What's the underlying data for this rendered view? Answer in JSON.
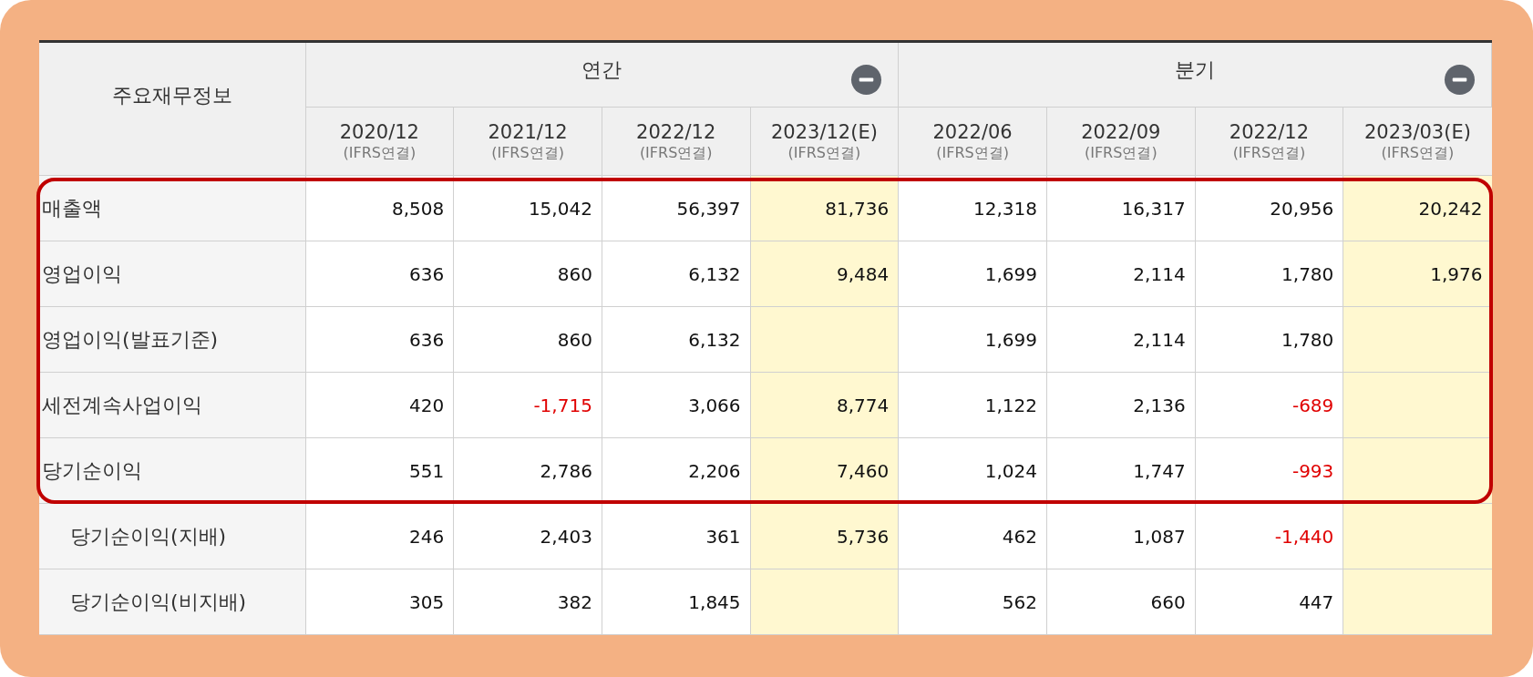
{
  "table": {
    "corner_label": "주요재무정보",
    "groups": [
      {
        "title": "연간",
        "expanded": true,
        "columns": [
          {
            "period": "2020/12",
            "basis": "(IFRS연결)",
            "estimate": false
          },
          {
            "period": "2021/12",
            "basis": "(IFRS연결)",
            "estimate": false
          },
          {
            "period": "2022/12",
            "basis": "(IFRS연결)",
            "estimate": false
          },
          {
            "period": "2023/12(E)",
            "basis": "(IFRS연결)",
            "estimate": true
          }
        ]
      },
      {
        "title": "분기",
        "expanded": true,
        "columns": [
          {
            "period": "2022/06",
            "basis": "(IFRS연결)",
            "estimate": false
          },
          {
            "period": "2022/09",
            "basis": "(IFRS연결)",
            "estimate": false
          },
          {
            "period": "2022/12",
            "basis": "(IFRS연결)",
            "estimate": false
          },
          {
            "period": "2023/03(E)",
            "basis": "(IFRS연결)",
            "estimate": true
          }
        ]
      }
    ],
    "rows": [
      {
        "label": "매출액",
        "outlined": true,
        "cells": [
          {
            "text": "8,508",
            "negative": false
          },
          {
            "text": "15,042",
            "negative": false
          },
          {
            "text": "56,397",
            "negative": false
          },
          {
            "text": "81,736",
            "negative": false
          },
          {
            "text": "12,318",
            "negative": false
          },
          {
            "text": "16,317",
            "negative": false
          },
          {
            "text": "20,956",
            "negative": false
          },
          {
            "text": "20,242",
            "negative": false
          }
        ]
      },
      {
        "label": "영업이익",
        "outlined": true,
        "cells": [
          {
            "text": "636",
            "negative": false
          },
          {
            "text": "860",
            "negative": false
          },
          {
            "text": "6,132",
            "negative": false
          },
          {
            "text": "9,484",
            "negative": false
          },
          {
            "text": "1,699",
            "negative": false
          },
          {
            "text": "2,114",
            "negative": false
          },
          {
            "text": "1,780",
            "negative": false
          },
          {
            "text": "1,976",
            "negative": false
          }
        ]
      },
      {
        "label": "영업이익(발표기준)",
        "outlined": true,
        "cells": [
          {
            "text": "636",
            "negative": false
          },
          {
            "text": "860",
            "negative": false
          },
          {
            "text": "6,132",
            "negative": false
          },
          null,
          {
            "text": "1,699",
            "negative": false
          },
          {
            "text": "2,114",
            "negative": false
          },
          {
            "text": "1,780",
            "negative": false
          },
          null
        ]
      },
      {
        "label": "세전계속사업이익",
        "outlined": true,
        "cells": [
          {
            "text": "420",
            "negative": false
          },
          {
            "text": "-1,715",
            "negative": true
          },
          {
            "text": "3,066",
            "negative": false
          },
          {
            "text": "8,774",
            "negative": false
          },
          {
            "text": "1,122",
            "negative": false
          },
          {
            "text": "2,136",
            "negative": false
          },
          {
            "text": "-689",
            "negative": true
          },
          null
        ]
      },
      {
        "label": "당기순이익",
        "outlined": true,
        "cells": [
          {
            "text": "551",
            "negative": false
          },
          {
            "text": "2,786",
            "negative": false
          },
          {
            "text": "2,206",
            "negative": false
          },
          {
            "text": "7,460",
            "negative": false
          },
          {
            "text": "1,024",
            "negative": false
          },
          {
            "text": "1,747",
            "negative": false
          },
          {
            "text": "-993",
            "negative": true
          },
          null
        ],
        "children": [
          {
            "label": "당기순이익(지배)",
            "outlined": false,
            "cells": [
              {
                "text": "246",
                "negative": false
              },
              {
                "text": "2,403",
                "negative": false
              },
              {
                "text": "361",
                "negative": false
              },
              {
                "text": "5,736",
                "negative": false
              },
              {
                "text": "462",
                "negative": false
              },
              {
                "text": "1,087",
                "negative": false
              },
              {
                "text": "-1,440",
                "negative": true
              },
              null
            ]
          },
          {
            "label": "당기순이익(비지배)",
            "outlined": false,
            "cells": [
              {
                "text": "305",
                "negative": false
              },
              {
                "text": "382",
                "negative": false
              },
              {
                "text": "1,845",
                "negative": false
              },
              null,
              {
                "text": "562",
                "negative": false
              },
              {
                "text": "660",
                "negative": false
              },
              {
                "text": "447",
                "negative": false
              },
              null
            ]
          }
        ]
      }
    ]
  }
}
